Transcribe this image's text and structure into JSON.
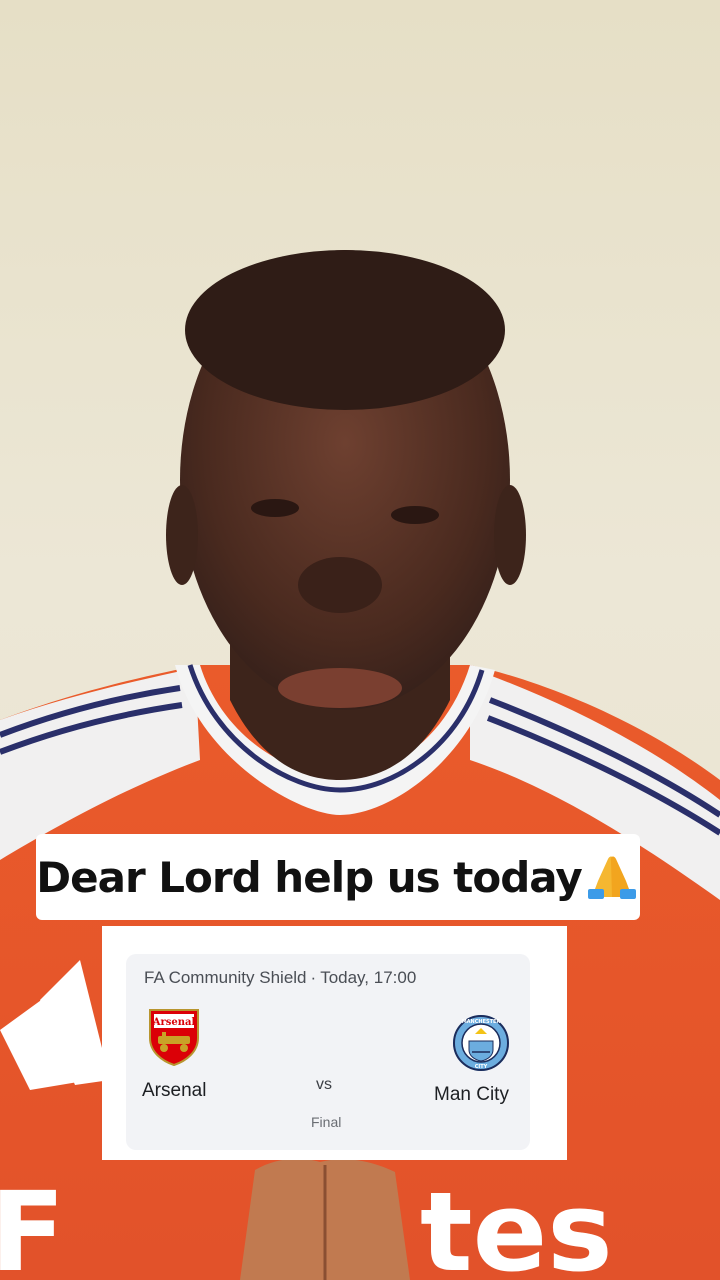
{
  "caption": {
    "text": "Dear Lord help us today",
    "emoji_icon": "folded-hands-icon"
  },
  "match": {
    "competition": "FA Community Shield",
    "separator": "·",
    "kickoff": "Today, 17:00",
    "home_team": "Arsenal",
    "home_crest_text": "Arsenal",
    "away_team": "Man City",
    "away_crest_text": "MANCHESTER CITY",
    "vs": "vs",
    "status": "Final"
  },
  "colors": {
    "shirt_red": "#e8582a",
    "arsenal_red": "#db0007",
    "city_blue": "#6caddf",
    "card_bg": "#f2f3f6"
  }
}
